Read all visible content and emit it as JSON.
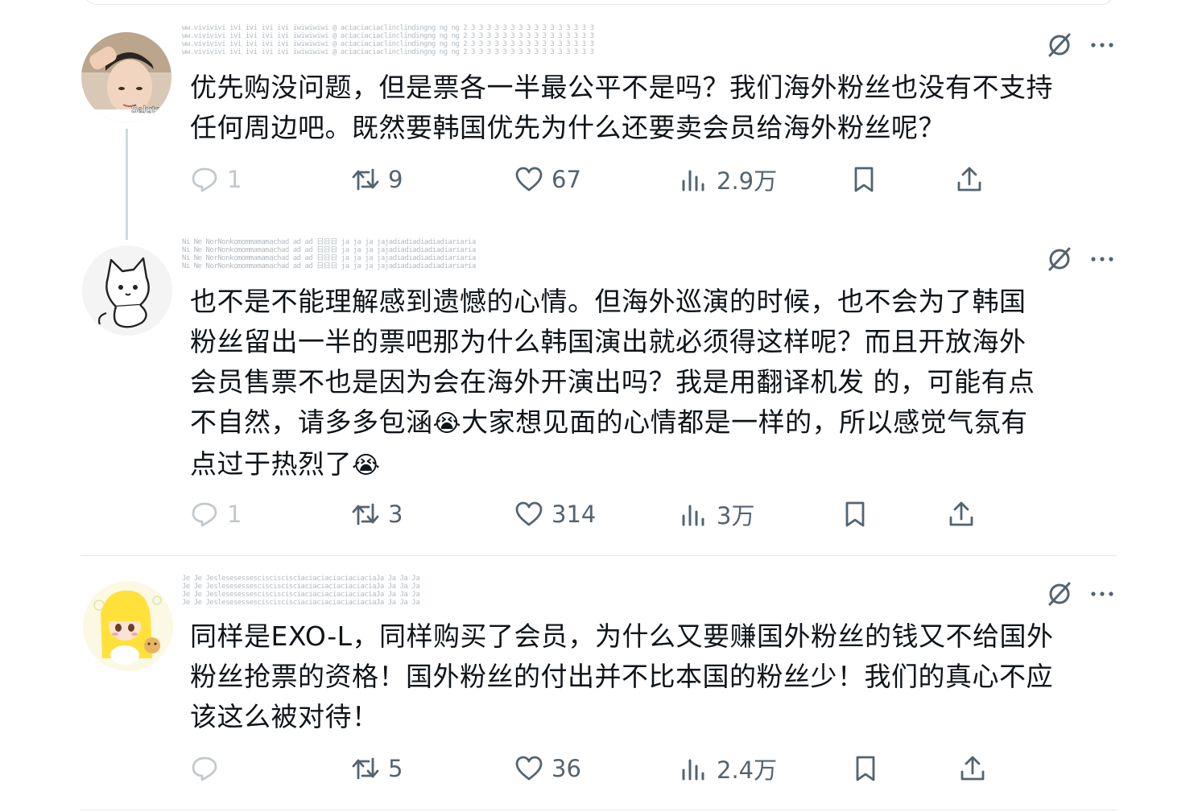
{
  "replies": [
    {
      "handle": "ww.vivivivi ivi ivi ivi ivi iwiwiwiwi @ aciaciaciaclinclindingng ng ng 2 3 3 3 3 3 3 3 3 3 3 3 3 3 3 3 3",
      "text_lines": [
        "优先购没问题，但是票各一半最公平不是吗？我们海外粉丝也没有不支持",
        "任何周边吧。既然要韩国优先为什么还要卖会员给海外粉丝呢？"
      ],
      "avatar_caption": "Salute",
      "stats": {
        "replies": "1",
        "reposts": "9",
        "likes": "67",
        "views": "2.9万"
      }
    },
    {
      "handle": "Ni Ne NorNonkomommamamachad ad ad 日日日 ja ja ja jajadiadiadiadiadiariaria",
      "text_lines": [
        "也不是不能理解感到遗憾的心情。但海外巡演的时候，也不会为了韩国",
        "粉丝留出一半的票吧那为什么韩国演出就必须得这样呢？而且开放海外",
        "会员售票不也是因为会在海外开演出吗？我是用翻译机发 的，可能有点"
      ],
      "text_line4_a": "不自然，请多多包涵",
      "text_line4_b": "大家想见面的心情都是一样的，所以感觉气氛有",
      "text_line5": "点过于热烈了",
      "emoji": "😭",
      "stats": {
        "replies": "1",
        "reposts": "3",
        "likes": "314",
        "views": "3万"
      }
    },
    {
      "handle": "Je Je JeslesesessescisciscisciaciaciaciaciaciaciaJa Ja Ja Ja",
      "text_lines": [
        "同样是EXO-L，同样购买了会员，为什么又要赚国外粉丝的钱又不给国外",
        "粉丝抢票的资格！国外粉丝的付出并不比本国的粉丝少！我们的真心不应",
        "该这么被对待！"
      ],
      "stats": {
        "replies": "",
        "reposts": "5",
        "likes": "36",
        "views": "2.4万"
      }
    }
  ],
  "colors": {
    "text": "#0f1419",
    "muted": "#536471",
    "divider": "#e1e6ea"
  }
}
